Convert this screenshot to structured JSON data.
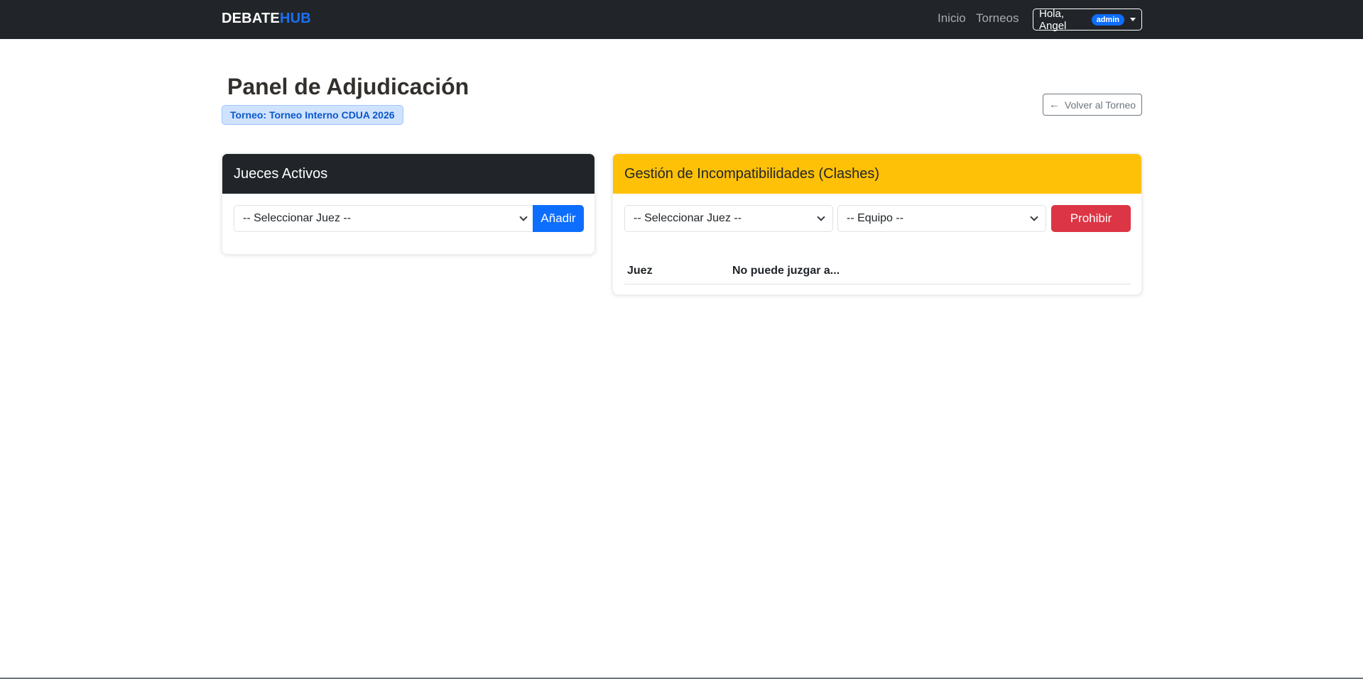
{
  "navbar": {
    "brand_part1": "DEBATE",
    "brand_part2": "HUB",
    "links": [
      {
        "label": "Inicio"
      },
      {
        "label": "Torneos"
      }
    ],
    "user_greeting": "Hola, Angel",
    "user_role": "admin"
  },
  "header": {
    "title": "Panel de Adjudicación",
    "tournament_badge": "Torneo: Torneo Interno CDUA 2026",
    "back_button": "Volver al Torneo"
  },
  "judges_card": {
    "title": "Jueces Activos",
    "select_value": "-- Seleccionar Juez --",
    "add_button": "Añadir"
  },
  "clashes_card": {
    "title": "Gestión de Incompatibilidades (Clashes)",
    "judge_select_value": "-- Seleccionar Juez --",
    "team_select_value": "-- Equipo --",
    "prohibit_button": "Prohibir",
    "table_headers": [
      "Juez",
      "No puede juzgar a..."
    ]
  },
  "colors": {
    "navbar_bg": "#212529",
    "brand_accent": "#1c6ff5",
    "primary": "#0d6efd",
    "warning": "#ffc107",
    "danger": "#dc3545"
  },
  "icons": {
    "back": "arrow-left-icon",
    "dropdown": "chevron-down-icon",
    "user_menu": "caret-down-icon"
  }
}
